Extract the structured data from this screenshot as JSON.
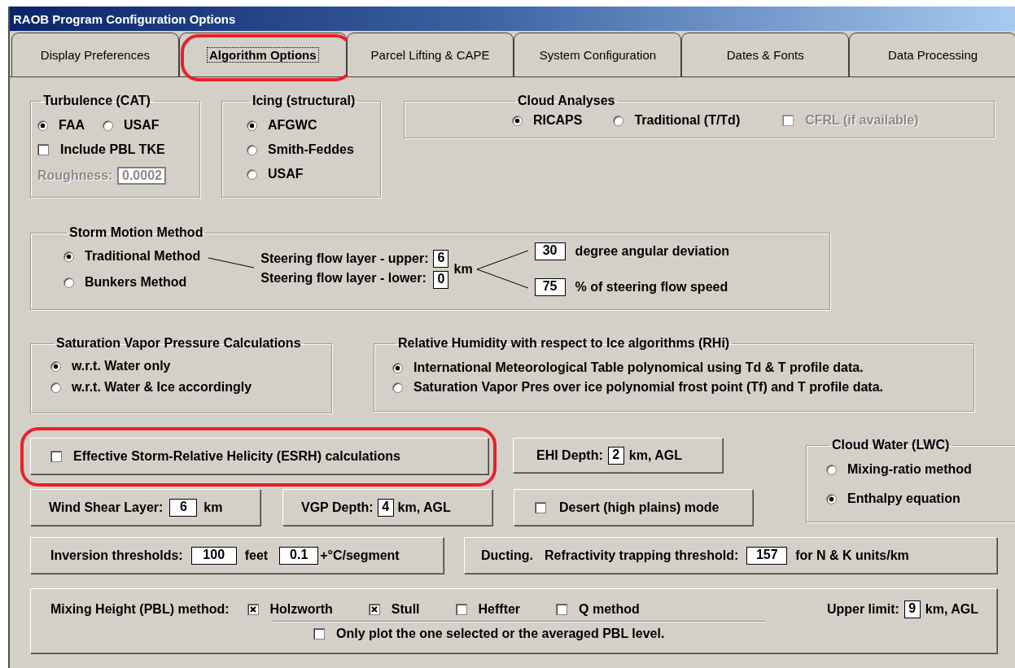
{
  "window": {
    "title": "RAOB Program Configuration Options"
  },
  "tabs": [
    {
      "label": "Display Preferences",
      "selected": false,
      "highlighted": false
    },
    {
      "label": "Algorithm Options",
      "selected": true,
      "highlighted": true
    },
    {
      "label": "Parcel Lifting & CAPE",
      "selected": false,
      "highlighted": false
    },
    {
      "label": "System Configuration",
      "selected": false,
      "highlighted": false
    },
    {
      "label": "Dates & Fonts",
      "selected": false,
      "highlighted": false
    },
    {
      "label": "Data Processing",
      "selected": false,
      "highlighted": false
    }
  ],
  "turbulence": {
    "title": "Turbulence (CAT)",
    "options": [
      {
        "label": "FAA",
        "selected": true
      },
      {
        "label": "USAF",
        "selected": false
      }
    ],
    "pbl_tke": {
      "label": "Include PBL TKE",
      "checked": false
    },
    "roughness": {
      "label": "Roughness:",
      "value": "0.0002",
      "disabled": true
    }
  },
  "icing": {
    "title": "Icing (structural)",
    "options": [
      {
        "label": "AFGWC",
        "selected": true
      },
      {
        "label": "Smith-Feddes",
        "selected": false
      },
      {
        "label": "USAF",
        "selected": false
      }
    ]
  },
  "cloud_analyses": {
    "title": "Cloud Analyses",
    "options": [
      {
        "label": "RICAPS",
        "selected": true
      },
      {
        "label": "Traditional (T/Td)",
        "selected": false
      }
    ],
    "cfrl": {
      "label": "CFRL (if available)",
      "checked": false,
      "disabled": true
    }
  },
  "storm_motion": {
    "title": "Storm Motion Method",
    "options": [
      {
        "label": "Traditional Method",
        "selected": true
      },
      {
        "label": "Bunkers Method",
        "selected": false
      }
    ],
    "upper": {
      "label": "Steering flow layer - upper:",
      "value": "6"
    },
    "lower": {
      "label": "Steering flow layer - lower:",
      "value": "0"
    },
    "layer_unit": "km",
    "deviation": {
      "value": "30",
      "label": "degree angular deviation"
    },
    "speed": {
      "value": "75",
      "label": "% of steering flow speed"
    }
  },
  "saturation_vapor_pressure": {
    "title": "Saturation Vapor Pressure Calculations",
    "options": [
      {
        "label": "w.r.t. Water only",
        "selected": true
      },
      {
        "label": "w.r.t. Water & Ice accordingly",
        "selected": false
      }
    ]
  },
  "rhi": {
    "title": "Relative Humidity with respect to Ice algorithms (RHi)",
    "options": [
      {
        "label": "International Meteorological Table polynomical using Td & T profile data.",
        "selected": true
      },
      {
        "label": "Saturation Vapor Pres over ice polynomial frost point (Tf) and T profile data.",
        "selected": false
      }
    ]
  },
  "esrh": {
    "label": "Effective Storm-Relative Helicity (ESRH) calculations",
    "checked": false,
    "highlighted": true
  },
  "ehi_depth": {
    "label": "EHI Depth:",
    "value": "2",
    "unit": "km, AGL"
  },
  "cloud_water": {
    "title": "Cloud Water (LWC)",
    "options": [
      {
        "label": "Mixing-ratio method",
        "selected": false
      },
      {
        "label": "Enthalpy equation",
        "selected": true
      }
    ]
  },
  "wind_shear": {
    "label": "Wind Shear Layer:",
    "value": "6",
    "unit": "km"
  },
  "vgp_depth": {
    "label": "VGP Depth:",
    "value": "4",
    "unit": "km, AGL"
  },
  "desert_mode": {
    "label": "Desert (high plains) mode",
    "checked": false
  },
  "inversion": {
    "label": "Inversion thresholds:",
    "height_value": "100",
    "height_unit": "feet",
    "lapse_value": "0.1",
    "lapse_unit": "+°C/segment"
  },
  "ducting": {
    "label": "Ducting.",
    "threshold_label": "Refractivity trapping threshold:",
    "value": "157",
    "unit": "for N & K units/km"
  },
  "mixing_height": {
    "label": "Mixing Height (PBL) method:",
    "methods": [
      {
        "label": "Holzworth",
        "checked": true
      },
      {
        "label": "Stull",
        "checked": true
      },
      {
        "label": "Heffter",
        "checked": false
      },
      {
        "label": "Q method",
        "checked": false
      }
    ],
    "upper_limit": {
      "label": "Upper limit:",
      "value": "9",
      "unit": "km, AGL"
    },
    "only_plot": {
      "label": "Only plot the one selected or the averaged PBL level.",
      "checked": false
    }
  }
}
